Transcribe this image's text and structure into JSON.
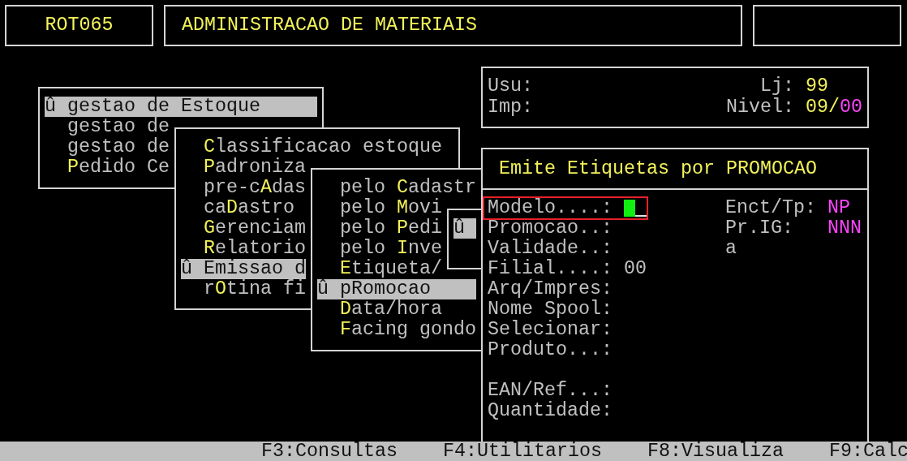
{
  "header": {
    "code": "ROT065",
    "title": "ADMINISTRACAO DE MATERIAIS"
  },
  "menus": [
    {
      "items": [
        {
          "marker": "û",
          "pre": "gestao de Estoque",
          "selected": true
        },
        {
          "pre": "gestao de",
          "selected": false
        },
        {
          "pre": "gestao de",
          "selected": false
        },
        {
          "key": "P",
          "post": "edido Ce",
          "selected": false
        }
      ]
    },
    {
      "items": [
        {
          "key": "C",
          "post": "lassificacao estoque",
          "selected": false
        },
        {
          "key": "P",
          "post": "adroniza",
          "selected": false
        },
        {
          "pre": "pre-c",
          "key": "A",
          "post": "das",
          "selected": false
        },
        {
          "pre": "ca",
          "key": "D",
          "post": "astro",
          "selected": false
        },
        {
          "key": "G",
          "post": "erenciam",
          "selected": false
        },
        {
          "key": "R",
          "post": "elatorio",
          "selected": false
        },
        {
          "marker": "û",
          "pre": "Emissao d",
          "selected": true
        },
        {
          "pre": "r",
          "key": "O",
          "post": "tina fi",
          "selected": false
        }
      ]
    },
    {
      "items": [
        {
          "pre": "pelo ",
          "key": "C",
          "post": "adastr",
          "selected": false
        },
        {
          "pre": "pelo ",
          "key": "M",
          "post": "ovi",
          "selected": false
        },
        {
          "pre": "pelo ",
          "key": "P",
          "post": "edi",
          "selected": false
        },
        {
          "pre": "pelo ",
          "key": "I",
          "post": "nve",
          "selected": false
        },
        {
          "key": "E",
          "post": "tiqueta/",
          "selected": false
        },
        {
          "marker": "û",
          "pre": "pRomocao",
          "selected": true
        },
        {
          "key": "D",
          "post": "ata/hora",
          "selected": false
        },
        {
          "key": "F",
          "post": "acing gondo",
          "selected": false
        }
      ]
    },
    {
      "items": [
        {
          "marker": "û",
          "selected": true
        }
      ]
    }
  ],
  "info": {
    "user_label": "Usu:",
    "printer_label": "Imp:",
    "store_label": "Lj:",
    "store": "99",
    "nivel_label": "Nivel:",
    "nivel": "09",
    "nivel_sep": "/",
    "nivel_sub": "00"
  },
  "form": {
    "title": "Emite Etiquetas por PROMOCAO",
    "field_groups": [
      [
        {
          "label": "Modelo....:",
          "focused": true
        },
        {
          "label": "Promocao..:",
          "focused": false
        },
        {
          "label": "Validade..:",
          "focused": false
        },
        {
          "label": "Filial....:",
          "value": "00",
          "focused": false
        },
        {
          "label": "Arq/Impres:",
          "focused": false
        },
        {
          "label": "Nome Spool:",
          "focused": false
        },
        {
          "label": "Selecionar:",
          "focused": false
        },
        {
          "label": "Produto...:",
          "focused": false
        }
      ],
      [
        {
          "label": "EAN/Ref...:",
          "focused": false
        },
        {
          "label": "Quantidade:",
          "focused": false
        }
      ]
    ],
    "side_fields": [
      {
        "label": "Enct/Tp:",
        "value": "NP"
      },
      {
        "label": "Pr.IG:",
        "value": "NNN"
      },
      {
        "label": "a"
      }
    ]
  },
  "footer": [
    "F3:Consultas",
    "F4:Utilitarios",
    "F8:Visualiza",
    "F9:Calc"
  ]
}
